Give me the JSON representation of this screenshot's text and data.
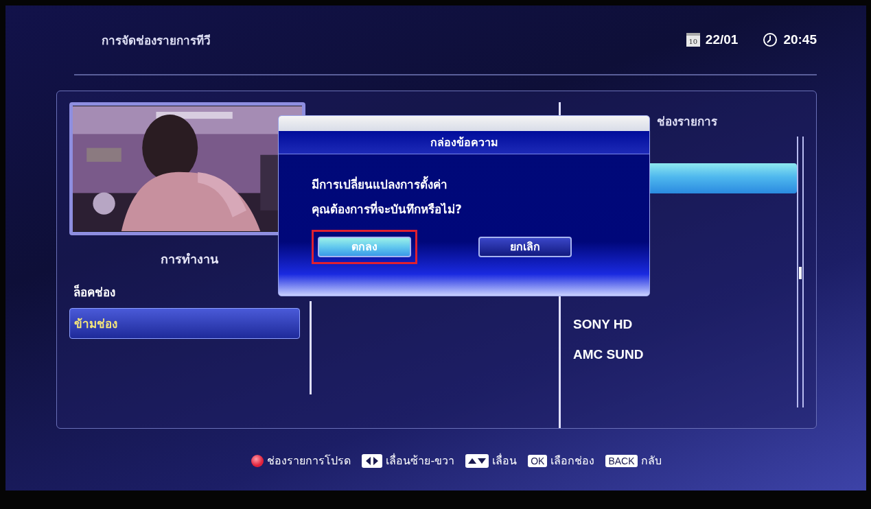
{
  "header": {
    "title": "การจัดช่องรายการทีวี",
    "calendar_day": "10",
    "date": "22/01",
    "time": "20:45"
  },
  "operations": {
    "heading": "การทำงาน",
    "items": [
      {
        "label": "ล็อคช่อง",
        "selected": false
      },
      {
        "label": "ข้ามช่อง",
        "selected": true
      }
    ]
  },
  "channels": {
    "heading": "ช่องรายการ",
    "items": [
      {
        "selected": true
      },
      {
        "name": "SONY HD",
        "selected": false
      },
      {
        "name": "AMC SUND",
        "selected": false
      }
    ]
  },
  "dialog": {
    "title": "กล่องข้อความ",
    "message": [
      "มีการเปลี่ยนแปลงการตั้งค่า",
      "คุณต้องการที่จะบันทึกหรือไม่?"
    ],
    "buttons": [
      {
        "label": "ตกลง",
        "selected": true,
        "highlighted": true
      },
      {
        "label": "ยกเลิก",
        "selected": false,
        "highlighted": false
      }
    ]
  },
  "footer": [
    {
      "kind": "dot",
      "label": "ช่องรายการโปรด"
    },
    {
      "kind": "leftright",
      "label": "เลื่อนซ้าย-ขวา"
    },
    {
      "kind": "updown",
      "label": "เลื่อน"
    },
    {
      "kind": "key",
      "key": "OK",
      "label": "เลือกช่อง"
    },
    {
      "kind": "key",
      "key": "BACK",
      "label": "กลับ"
    }
  ]
}
